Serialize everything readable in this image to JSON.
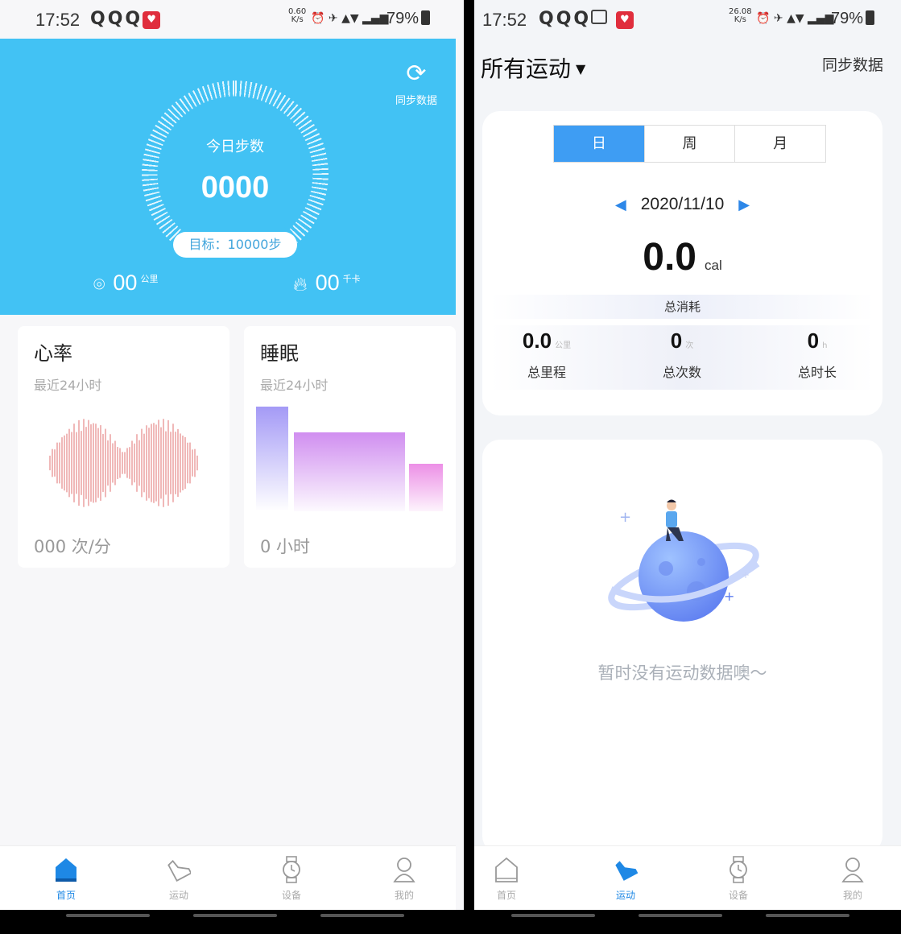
{
  "left": {
    "status": {
      "time": "17:52",
      "netspeed_value": "0.60",
      "netspeed_unit": "K/s",
      "battery": "79%"
    },
    "hero": {
      "sync_label": "同步数据",
      "today_steps_label": "今日步数",
      "steps_value": "0000",
      "goal_text": "目标：10000步",
      "distance_value": "00",
      "distance_unit": "公里",
      "calories_value": "00",
      "calories_unit": "千卡"
    },
    "heart": {
      "title": "心率",
      "subtitle": "最近24小时",
      "value_text": "000 次/分"
    },
    "sleep": {
      "title": "睡眠",
      "subtitle": "最近24小时",
      "value_text": "0 小时"
    },
    "nav": [
      {
        "label": "首页",
        "icon": "home-icon",
        "active": true
      },
      {
        "label": "运动",
        "icon": "shoe-icon",
        "active": false
      },
      {
        "label": "设备",
        "icon": "watch-icon",
        "active": false
      },
      {
        "label": "我的",
        "icon": "person-icon",
        "active": false
      }
    ]
  },
  "right": {
    "status": {
      "time": "17:52",
      "netspeed_value": "26.08",
      "netspeed_unit": "K/s",
      "battery": "79%"
    },
    "header": {
      "title": "所有运动",
      "sync_label": "同步数据"
    },
    "tabs": [
      "日",
      "周",
      "月"
    ],
    "selected_tab": "日",
    "date": "2020/11/10",
    "calories_value": "0.0",
    "calories_unit": "cal",
    "total_label": "总消耗",
    "metrics": [
      {
        "value": "0.0",
        "unit": "公里",
        "label": "总里程"
      },
      {
        "value": "0",
        "unit": "次",
        "label": "总次数"
      },
      {
        "value": "0",
        "unit": "h",
        "label": "总时长"
      }
    ],
    "empty_text": "暂时没有运动数据噢～",
    "nav": [
      {
        "label": "首页",
        "icon": "home-icon",
        "active": false
      },
      {
        "label": "运动",
        "icon": "shoe-icon",
        "active": true
      },
      {
        "label": "设备",
        "icon": "watch-icon",
        "active": false
      },
      {
        "label": "我的",
        "icon": "person-icon",
        "active": false
      }
    ]
  },
  "colors": {
    "hero_blue": "#42c2f4",
    "accent_blue": "#3e9df3",
    "sleep_purple": "#b49af7",
    "heart_red": "#e88a8a"
  }
}
